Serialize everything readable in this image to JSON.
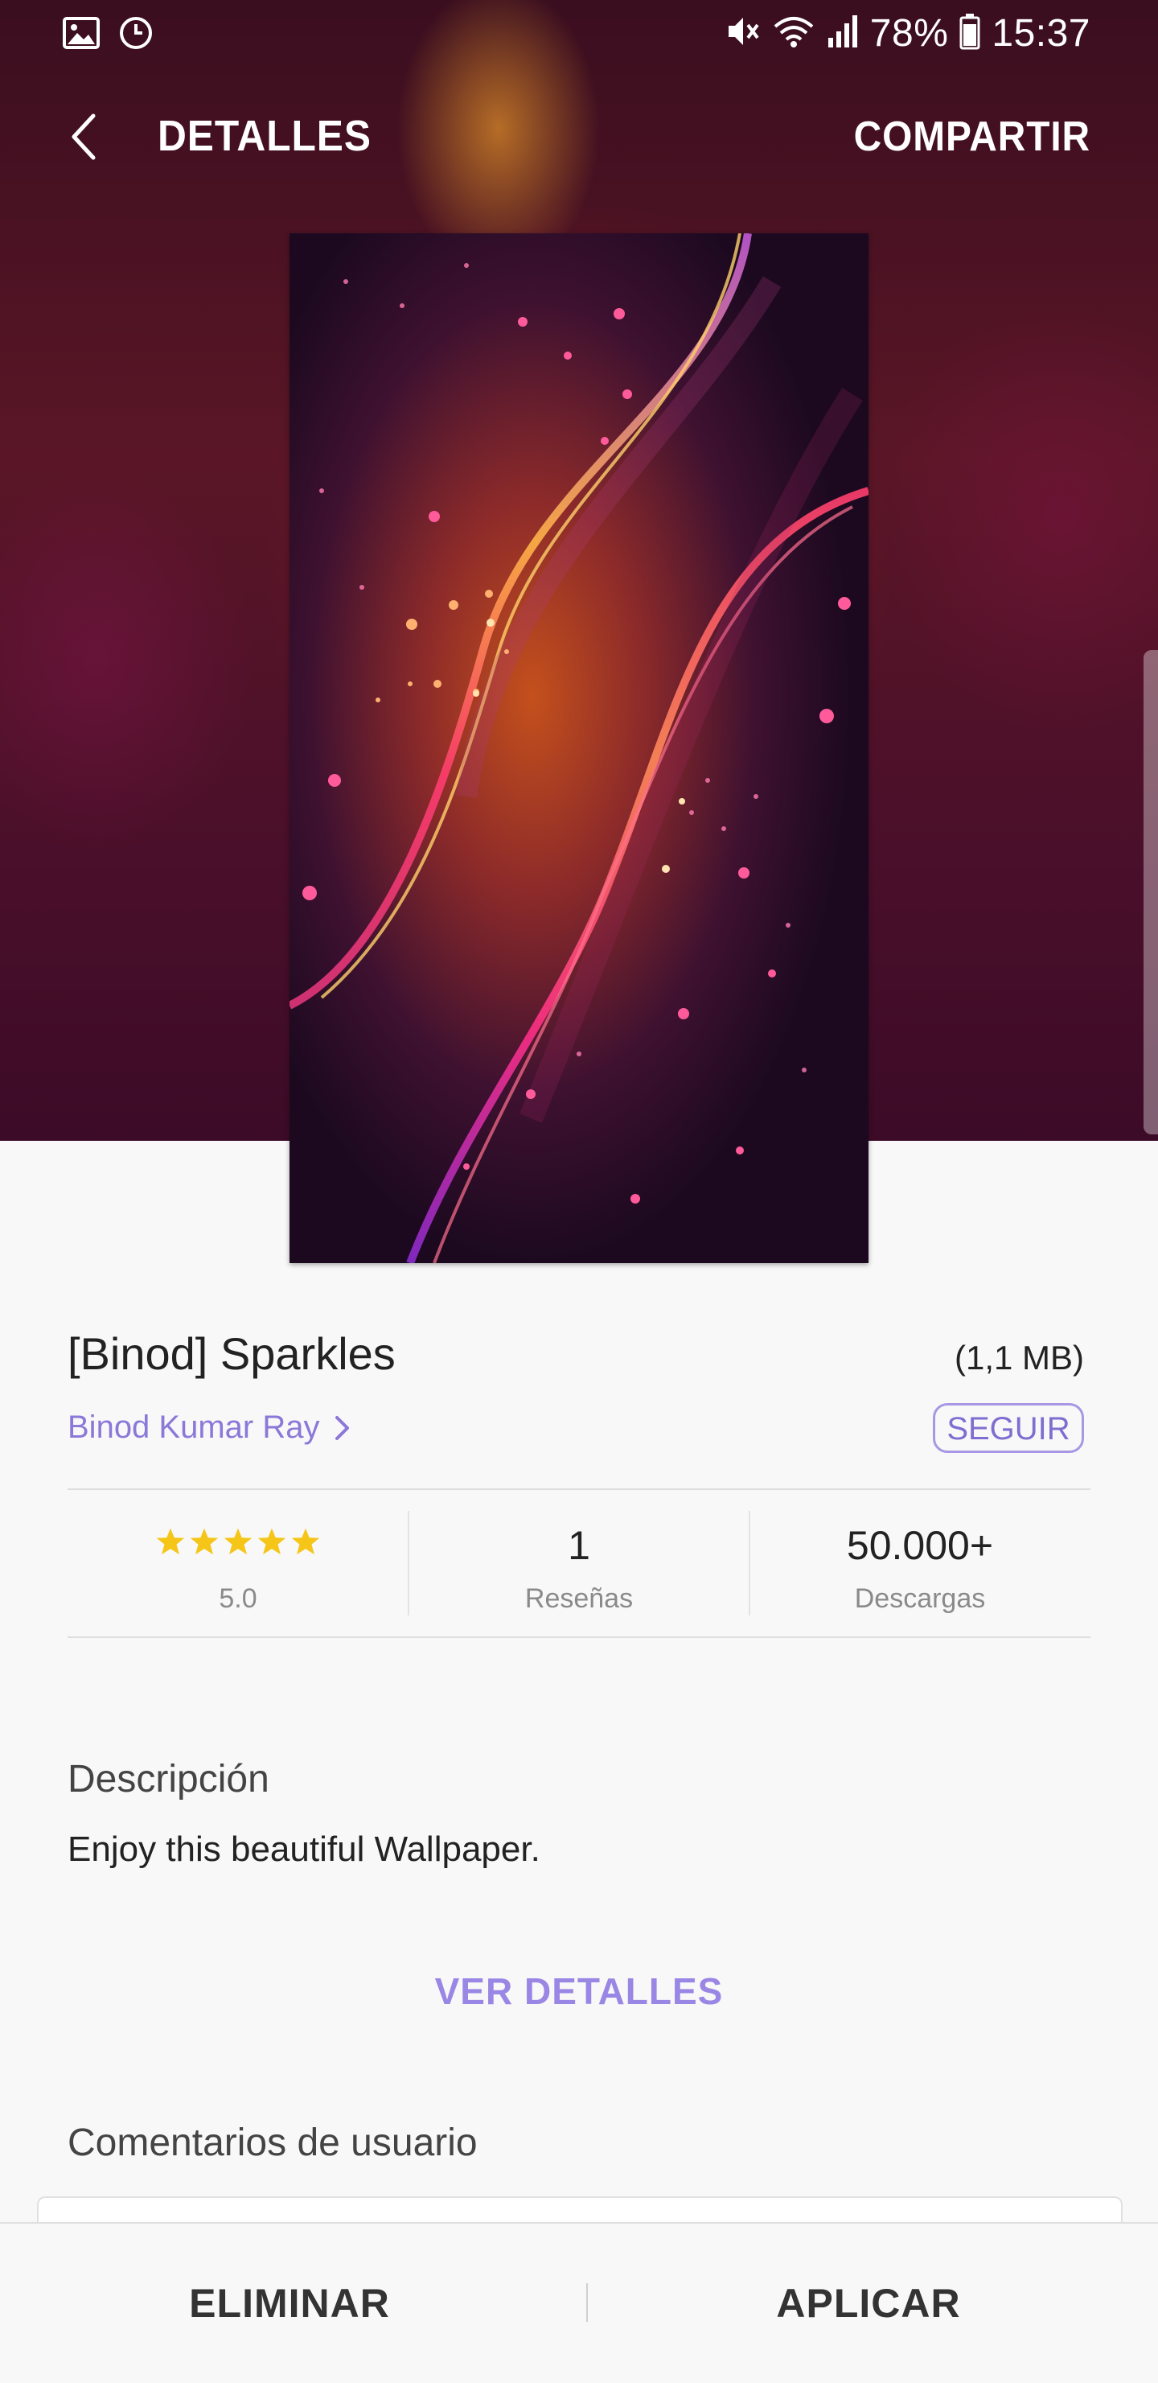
{
  "status_bar": {
    "battery": "78%",
    "time": "15:37",
    "icons": [
      "gallery-icon",
      "sync-icon",
      "mute-icon",
      "wifi-icon",
      "signal-icon",
      "battery-icon"
    ]
  },
  "app_bar": {
    "title": "DETALLES",
    "share_label": "COMPARTIR"
  },
  "wallpaper": {
    "name": "[Binod] Sparkles",
    "size": "(1,1 MB)",
    "author": "Binod Kumar Ray",
    "follow_label": "SEGUIR"
  },
  "stats": {
    "rating": "5.0",
    "rating_stars": 5,
    "reviews_count": "1",
    "reviews_label": "Reseñas",
    "downloads_count": "50.000+",
    "downloads_label": "Descargas"
  },
  "description": {
    "heading": "Descripción",
    "text": "Enjoy this beautiful Wallpaper."
  },
  "more_details_label": "VER DETALLES",
  "comments_heading": "Comentarios de usuario",
  "bottom_bar": {
    "delete_label": "ELIMINAR",
    "apply_label": "APLICAR"
  },
  "colors": {
    "accent": "#8b78d8",
    "star": "#f5c518"
  }
}
